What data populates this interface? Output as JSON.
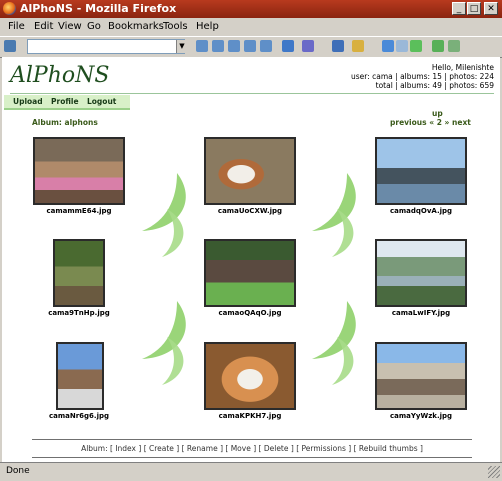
{
  "window": {
    "title": "AlPhoNS - Mozilla Firefox"
  },
  "menu": [
    "File",
    "Edit",
    "View",
    "Go",
    "Bookmarks",
    "Tools",
    "Help"
  ],
  "site": {
    "logo": "AlPhoNS",
    "greeting": "Hello, Milenishte",
    "user_stats": "user: cama | albums: 15 | photos: 224",
    "total_stats": "total | albums: 49 | photos: 659",
    "nav": [
      "Upload",
      "Profile",
      "Logout"
    ]
  },
  "album": {
    "title": "Album: alphons",
    "up": "up",
    "previous": "previous",
    "prev_marker": "«",
    "page": "2",
    "next_marker": "»",
    "next": "next",
    "photos": [
      "camammE64.jpg",
      "camaUoCXW.jpg",
      "camadqOvA.jpg",
      "cama9TnHp.jpg",
      "camaoQAqO.jpg",
      "camaLwIFY.jpg",
      "camaNr6g6.jpg",
      "camaKPKH7.jpg",
      "camaYyWzk.jpg"
    ]
  },
  "actions": {
    "label": "Album:",
    "items": [
      "[ Index ]",
      "[ Create ]",
      "[ Rename ]",
      "[ Move ]",
      "[ Delete ]",
      "[ Permissions ]",
      "[ Rebuild thumbs ]"
    ]
  },
  "status": {
    "text": "Done"
  },
  "colors": {
    "titlebar": "#a8301a",
    "accent_green": "#8fd06a",
    "link_green": "#3a5a1a"
  }
}
